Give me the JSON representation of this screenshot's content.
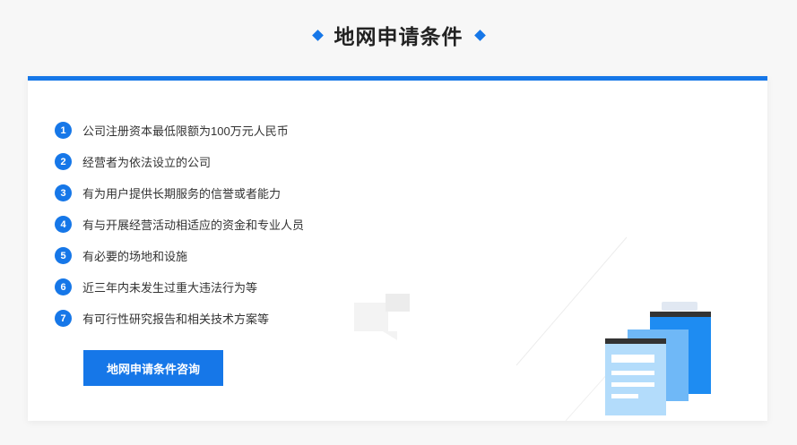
{
  "section": {
    "title": "地网申请条件"
  },
  "conditions": [
    {
      "num": "1",
      "text": "公司注册资本最低限额为100万元人民币"
    },
    {
      "num": "2",
      "text": "经营者为依法设立的公司"
    },
    {
      "num": "3",
      "text": "有为用户提供长期服务的信誉或者能力"
    },
    {
      "num": "4",
      "text": "有与开展经营活动相适应的资金和专业人员"
    },
    {
      "num": "5",
      "text": "有必要的场地和设施"
    },
    {
      "num": "6",
      "text": "近三年内未发生过重大违法行为等"
    },
    {
      "num": "7",
      "text": "有可行性研究报告和相关技术方案等"
    }
  ],
  "button": {
    "label": "地网申请条件咨询"
  },
  "colors": {
    "accent": "#1677e8"
  },
  "icons": [
    "diamond-icon",
    "mail-icon",
    "documents-icon"
  ]
}
